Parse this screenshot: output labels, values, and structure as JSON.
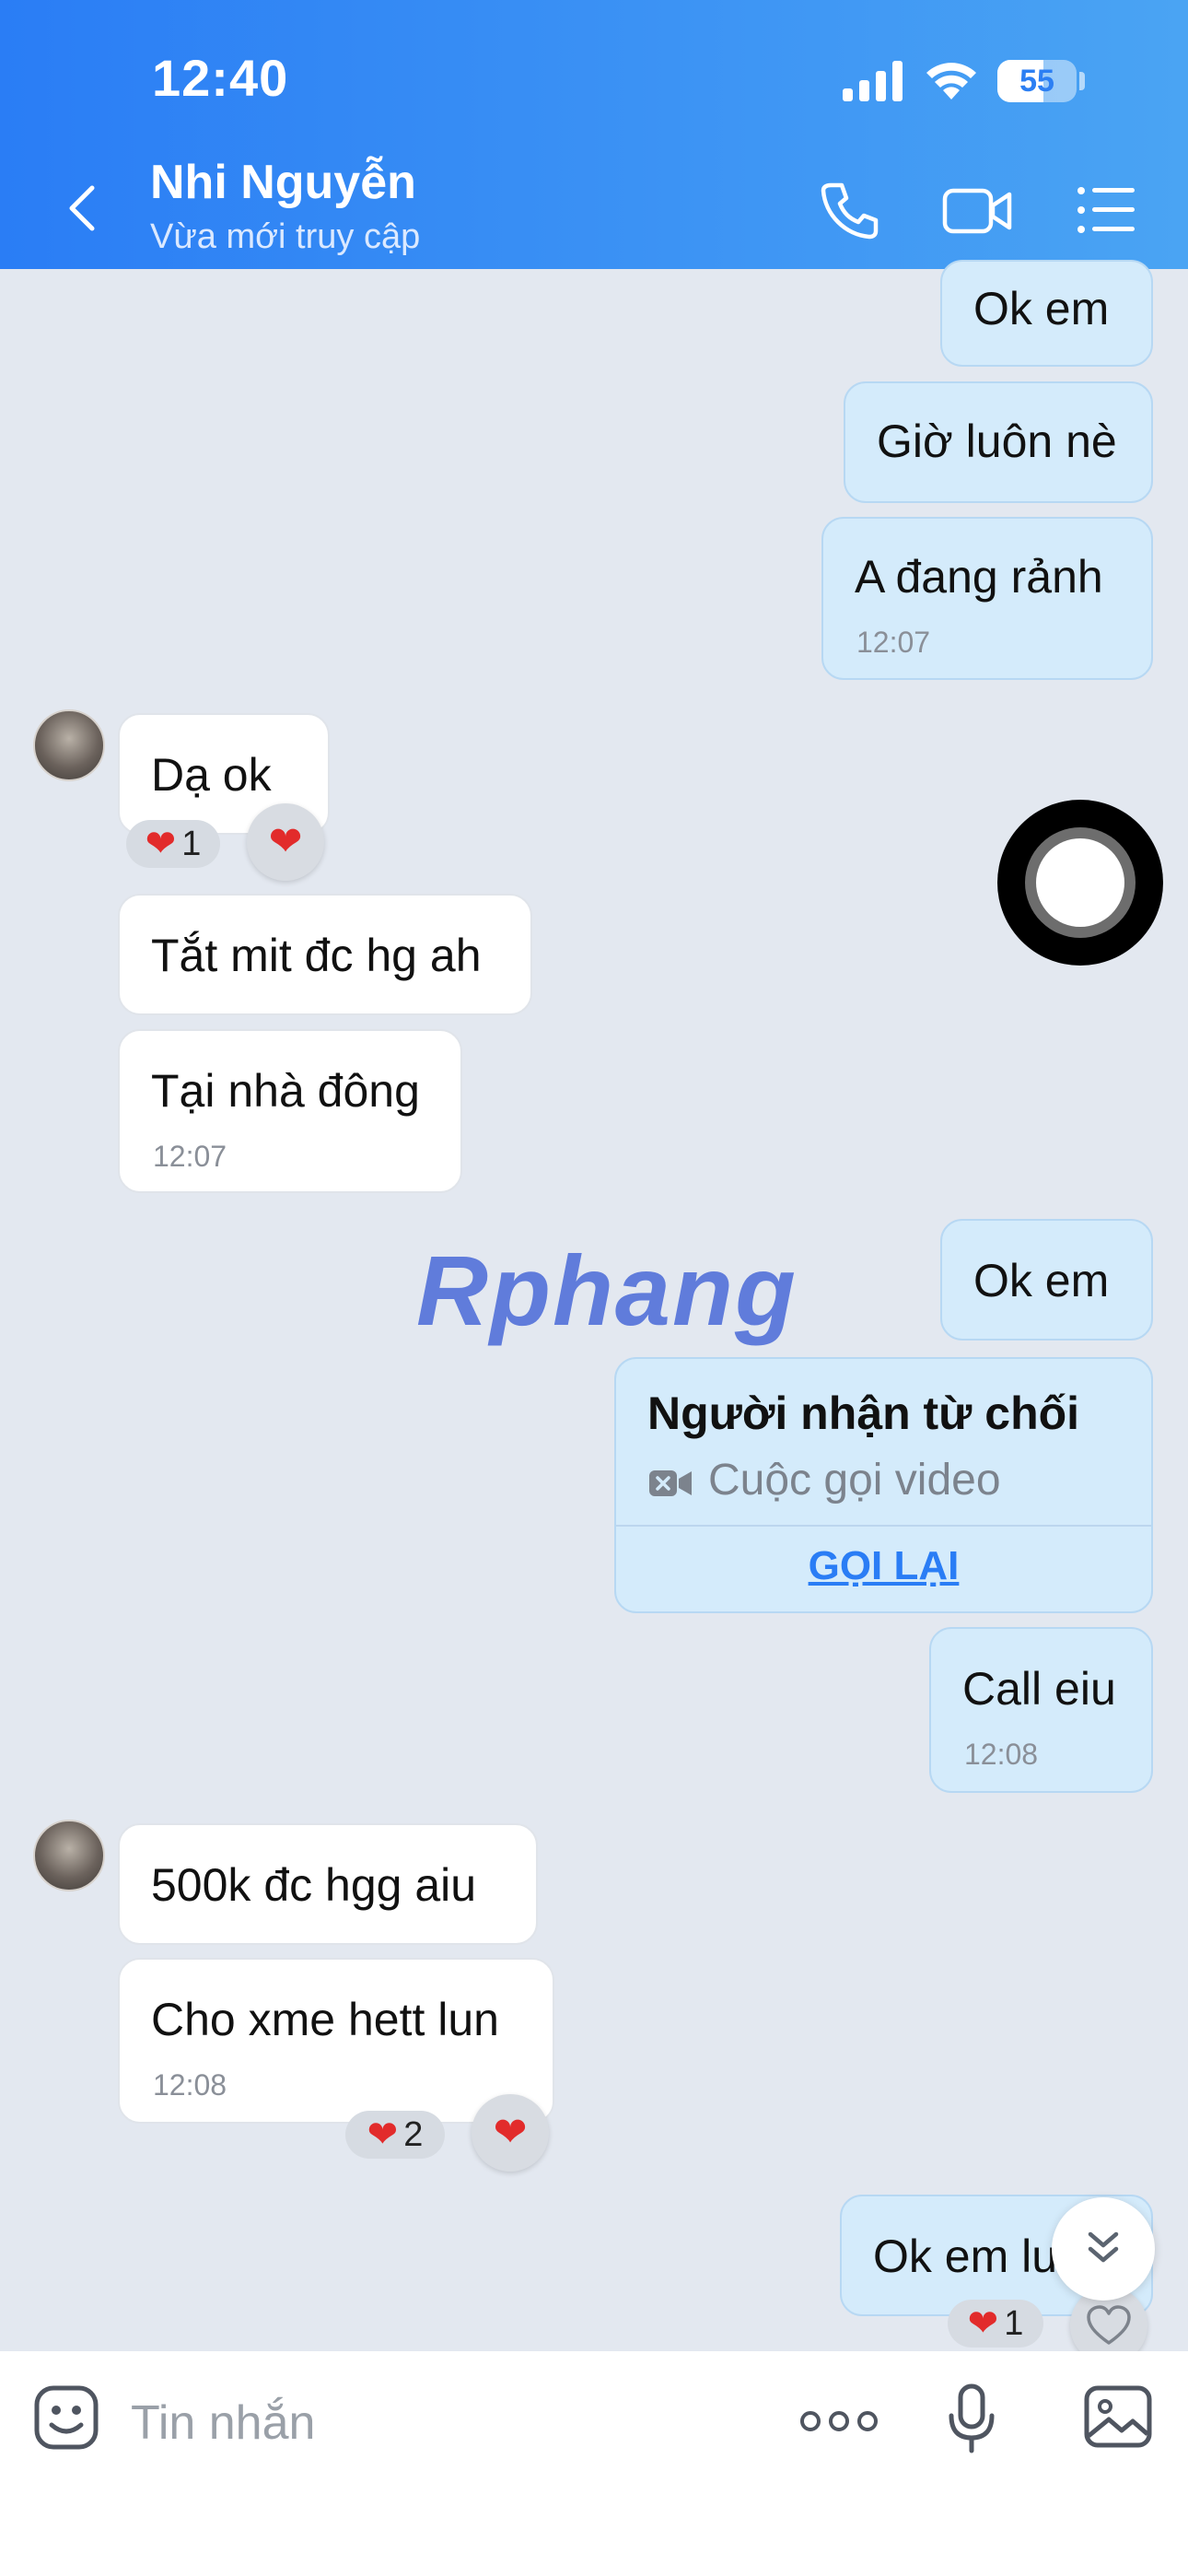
{
  "status_bar": {
    "time": "12:40",
    "battery_level": "55"
  },
  "header": {
    "contact_name": "Nhi Nguyễn",
    "contact_status": "Vừa mới truy cập",
    "icons": [
      "back-icon",
      "phone-icon",
      "video-call-icon",
      "menu-list-icon"
    ]
  },
  "messages": {
    "m1": {
      "text": "Ok em"
    },
    "m2": {
      "text": "Giờ luôn nè"
    },
    "m3": {
      "text": "A đang rảnh",
      "time": "12:07"
    },
    "m4": {
      "text": "Dạ ok",
      "reaction_count": "1"
    },
    "m5": {
      "text": "Tắt mit đc hg ah"
    },
    "m6": {
      "text": "Tại nhà đông",
      "time": "12:07"
    },
    "m7": {
      "text": "Ok em"
    },
    "call": {
      "title": "Người nhận từ chối",
      "subtitle": "Cuộc gọi video",
      "action": "GỌI LẠI"
    },
    "m8": {
      "text": "Call eiu",
      "time": "12:08"
    },
    "m9": {
      "text": "500k đc hgg aiu"
    },
    "m10": {
      "text": "Cho xme hett lun",
      "time": "12:08",
      "reaction_count": "2"
    },
    "m11": {
      "text": "Ok em lu",
      "reaction_count": "1"
    }
  },
  "watermark": "Rphang",
  "input": {
    "placeholder": "Tin nhắn",
    "more_label": "ooo"
  },
  "colors": {
    "header_start": "#2a7df5",
    "header_end": "#4aa4f3",
    "outgoing_bubble": "#d4ebfb",
    "incoming_bubble": "#ffffff",
    "accent": "#2a7df5",
    "heart": "#e22b2b"
  }
}
